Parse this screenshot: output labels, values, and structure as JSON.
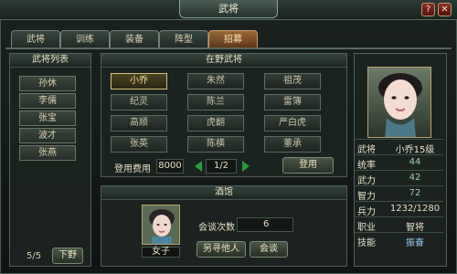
{
  "window": {
    "title": "武将",
    "help_label": "?",
    "close_label": "✕"
  },
  "tabs": [
    "武将",
    "训练",
    "装备",
    "阵型",
    "招募"
  ],
  "left_panel": {
    "title": "武将列表",
    "items": [
      "孙休",
      "李儒",
      "张宝",
      "波才",
      "张燕"
    ],
    "page_indicator": "5/5",
    "dismiss_label": "下野"
  },
  "wild_panel": {
    "title": "在野武将",
    "generals": [
      [
        "小乔",
        "朱然",
        "祖茂"
      ],
      [
        "纪灵",
        "陈兰",
        "雷簿"
      ],
      [
        "高顺",
        "虎翻",
        "严白虎"
      ],
      [
        "张英",
        "陈横",
        "董承"
      ]
    ],
    "cost_label": "登用费用",
    "cost_value": "8000",
    "page": "1/2",
    "recruit_label": "登用"
  },
  "tavern_panel": {
    "title": "酒馆",
    "person_label": "女子",
    "talk_count_label": "会谈次数",
    "talk_count_value": "6",
    "find_other_label": "另寻他人",
    "talk_label": "会谈"
  },
  "detail_panel": {
    "stats": [
      {
        "k": "武将",
        "v": "小乔15级"
      },
      {
        "k": "统率",
        "v": "44"
      },
      {
        "k": "武力",
        "v": "42"
      },
      {
        "k": "智力",
        "v": "72"
      },
      {
        "k": "兵力",
        "v": "1232/1280"
      },
      {
        "k": "职业",
        "v": "智将"
      },
      {
        "k": "技能",
        "v": "振奋"
      }
    ]
  }
}
